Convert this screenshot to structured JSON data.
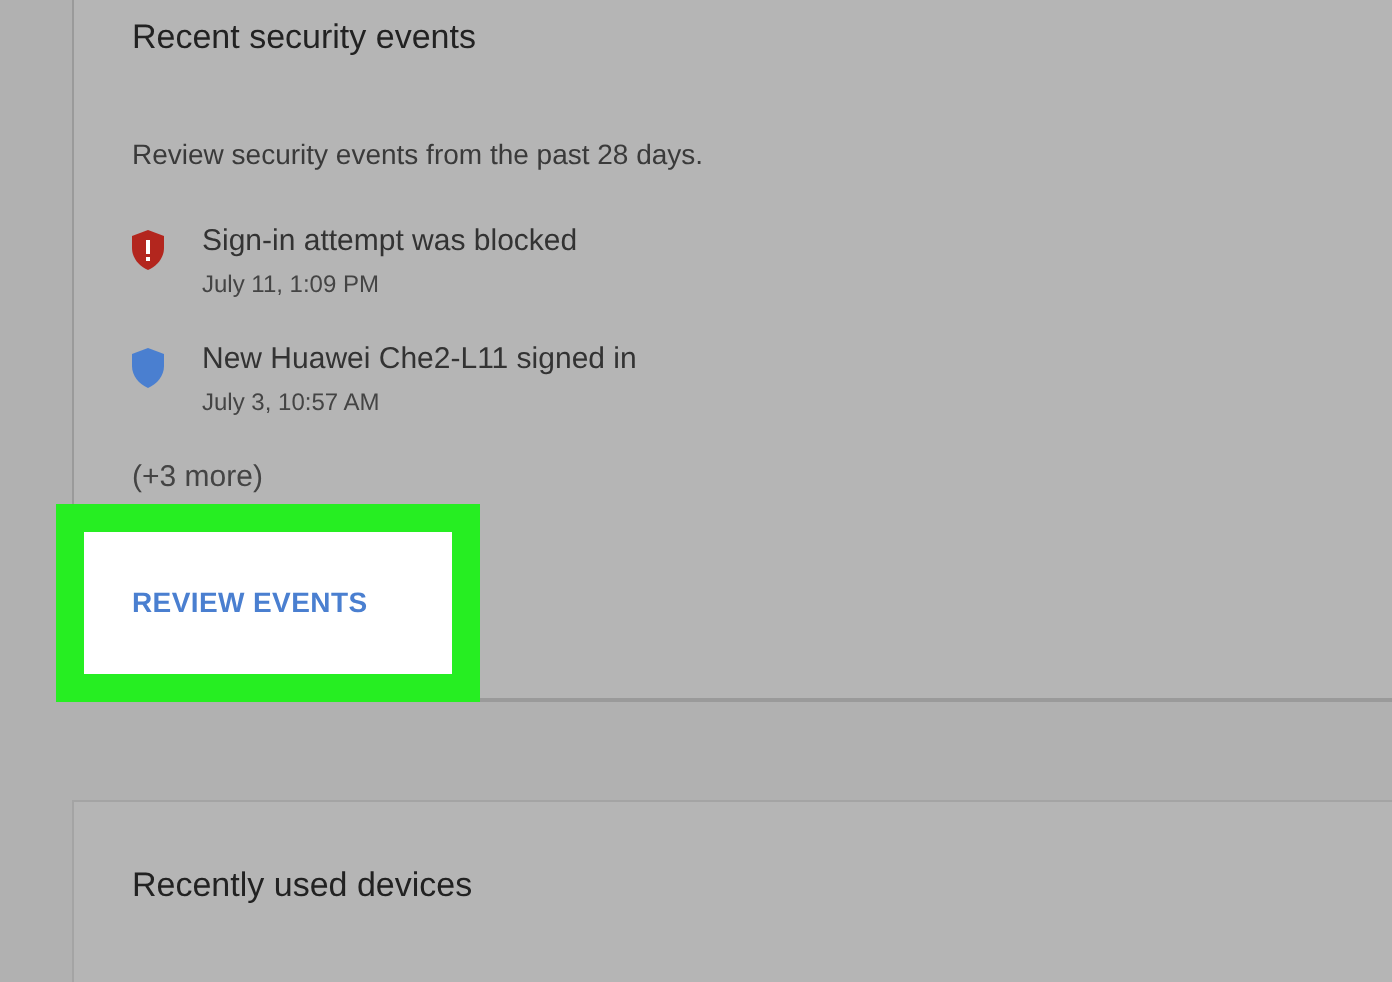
{
  "security_card": {
    "title": "Recent security events",
    "description": "Review security events from the past 28 days.",
    "events": [
      {
        "kind": "warning",
        "title": "Sign-in attempt was blocked",
        "time": "July 11, 1:09 PM"
      },
      {
        "kind": "info",
        "title": "New Huawei Che2-L11 signed in",
        "time": "July 3, 10:57 AM"
      }
    ],
    "more": "(+3 more)",
    "button": "REVIEW EVENTS",
    "highlighted": true
  },
  "devices_card": {
    "title": "Recently used devices"
  }
}
